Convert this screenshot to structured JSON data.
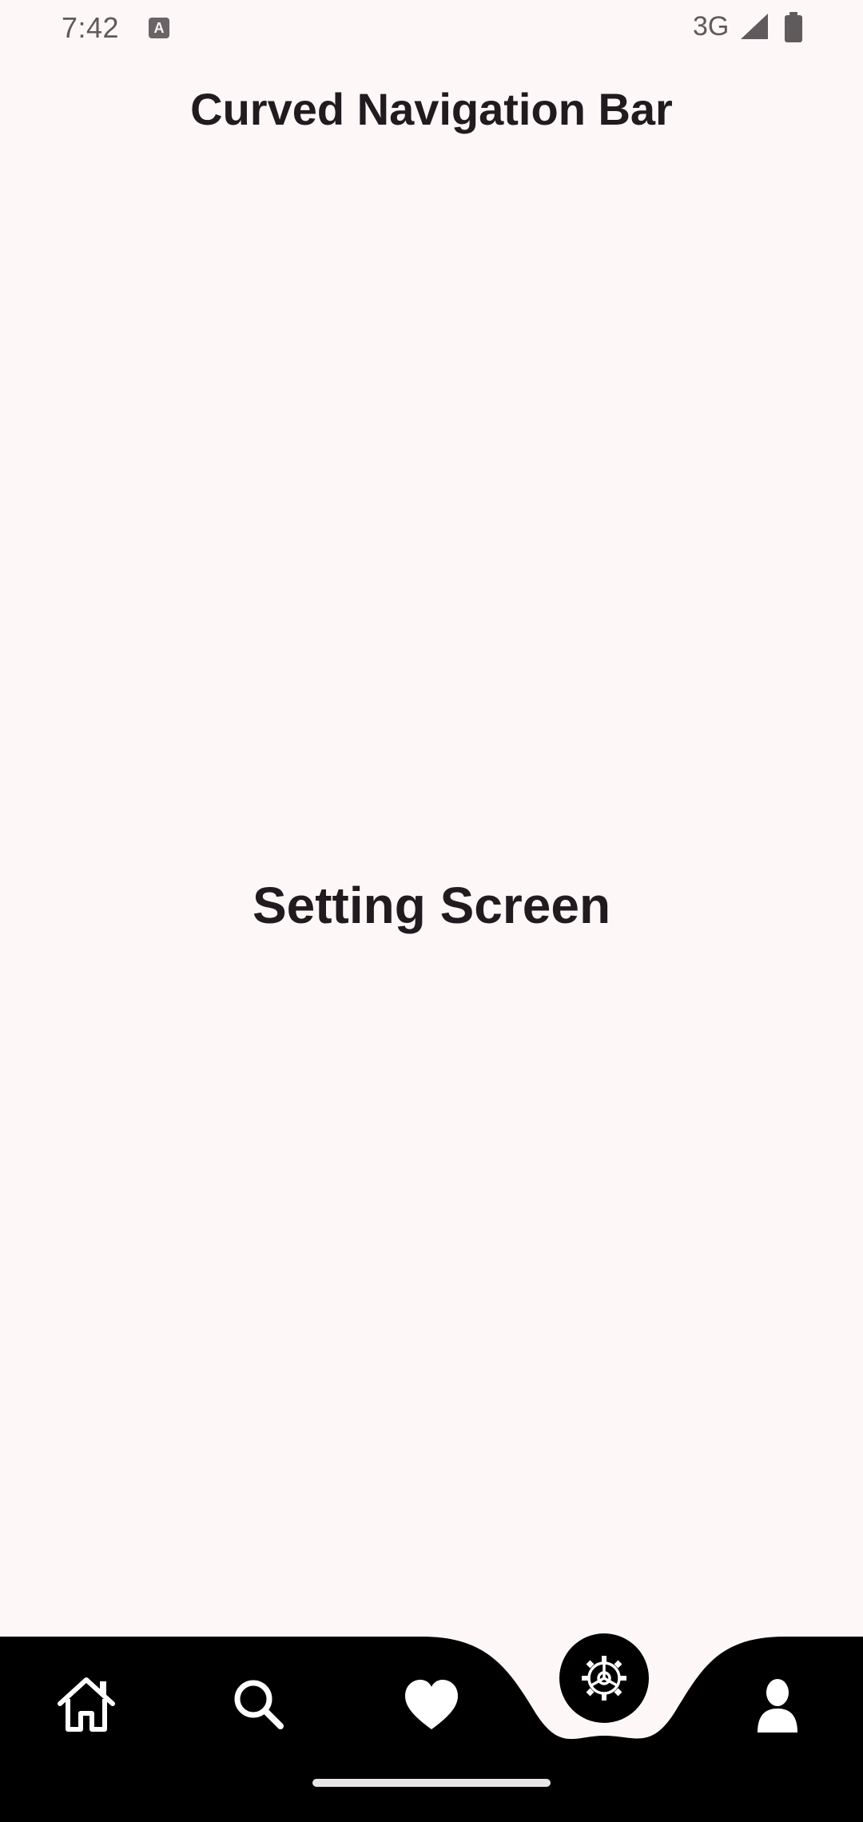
{
  "status_bar": {
    "time": "7:42",
    "notification_icon": "a-icon",
    "network": "3G",
    "signal_icon": "signal-icon",
    "battery_icon": "battery-icon"
  },
  "app": {
    "title": "Curved Navigation Bar"
  },
  "main": {
    "screen_label": "Setting Screen"
  },
  "bottom_nav": {
    "items": [
      {
        "icon": "home-icon",
        "active": false
      },
      {
        "icon": "search-icon",
        "active": false
      },
      {
        "icon": "heart-icon",
        "active": false
      },
      {
        "icon": "settings-icon",
        "active": true
      },
      {
        "icon": "profile-icon",
        "active": false
      }
    ],
    "background_color": "#000000",
    "page_color": "#fdf7f8",
    "icon_color": "#ffffff"
  }
}
